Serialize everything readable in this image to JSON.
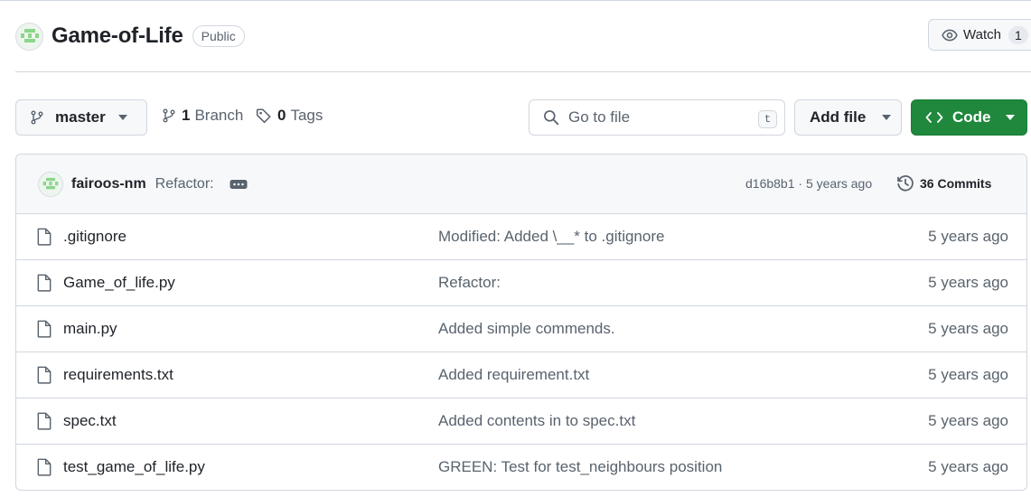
{
  "repo": {
    "name": "Game-of-Life",
    "visibility": "Public"
  },
  "watch": {
    "label": "Watch",
    "count": "1"
  },
  "toolbar": {
    "branch": "master",
    "branch_count": "1",
    "branch_word": "Branch",
    "tag_count": "0",
    "tag_word": "Tags",
    "search_placeholder": "Go to file",
    "search_shortcut": "t",
    "add_file": "Add file",
    "code": "Code"
  },
  "latest_commit": {
    "author": "fairoos-nm",
    "message": "Refactor:",
    "hash": "d16b8b1",
    "age": "5 years ago",
    "meta": "d16b8b1 · 5 years ago",
    "commit_count": "36 Commits"
  },
  "files": [
    {
      "name": ".gitignore",
      "commit": "Modified: Added \\__* to .gitignore",
      "age": "5 years ago"
    },
    {
      "name": "Game_of_life.py",
      "commit": "Refactor:",
      "age": "5 years ago"
    },
    {
      "name": "main.py",
      "commit": "Added simple commends.",
      "age": "5 years ago"
    },
    {
      "name": "requirements.txt",
      "commit": "Added requirement.txt",
      "age": "5 years ago"
    },
    {
      "name": "spec.txt",
      "commit": "Added contents in to spec.txt",
      "age": "5 years ago"
    },
    {
      "name": "test_game_of_life.py",
      "commit": "GREEN: Test for test_neighbours position",
      "age": "5 years ago"
    }
  ],
  "colors": {
    "primary_button": "#1f883d",
    "border": "#d0d7de",
    "muted_text": "#59636e",
    "avatar_green": "#8bd68b"
  },
  "icons": {
    "avatar": "identicon",
    "watch": "eye-icon",
    "branch": "git-branch-icon",
    "tag": "tag-icon",
    "search": "search-icon",
    "code": "code-icon",
    "caret": "triangle-down-icon",
    "history": "history-icon",
    "file": "file-icon",
    "ellipsis": "kebab-horizontal-icon"
  }
}
